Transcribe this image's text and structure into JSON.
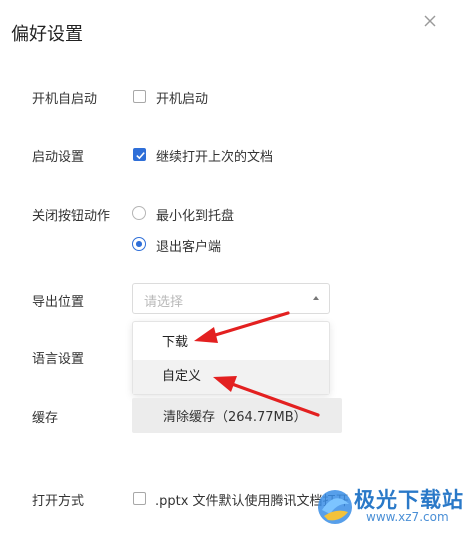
{
  "dialog": {
    "title": "偏好设置",
    "close_icon": "close-icon"
  },
  "settings": {
    "startup": {
      "label": "开机自启动",
      "option_label": "开机启动",
      "checked": false
    },
    "launch": {
      "label": "启动设置",
      "option_label": "继续打开上次的文档",
      "checked": true
    },
    "close_action": {
      "label": "关闭按钮动作",
      "options": [
        {
          "label": "最小化到托盘",
          "selected": false
        },
        {
          "label": "退出客户端",
          "selected": true
        }
      ]
    },
    "export": {
      "label": "导出位置",
      "placeholder": "请选择",
      "dropdown_open": true,
      "options": [
        {
          "label": "下载"
        },
        {
          "label": "自定义"
        }
      ]
    },
    "language": {
      "label": "语言设置"
    },
    "cache": {
      "label": "缓存",
      "button_label": "清除缓存（264.77MB）"
    },
    "open_mode": {
      "label": "打开方式",
      "option_label": ".pptx 文件默认使用腾讯文档打开",
      "checked": false
    }
  },
  "colors": {
    "accent": "#2f6fd8",
    "annotation_arrow": "#e32020",
    "watermark": "#2a79c8"
  },
  "watermark": {
    "text": "极光下载站",
    "url": "www.xz7.com"
  }
}
